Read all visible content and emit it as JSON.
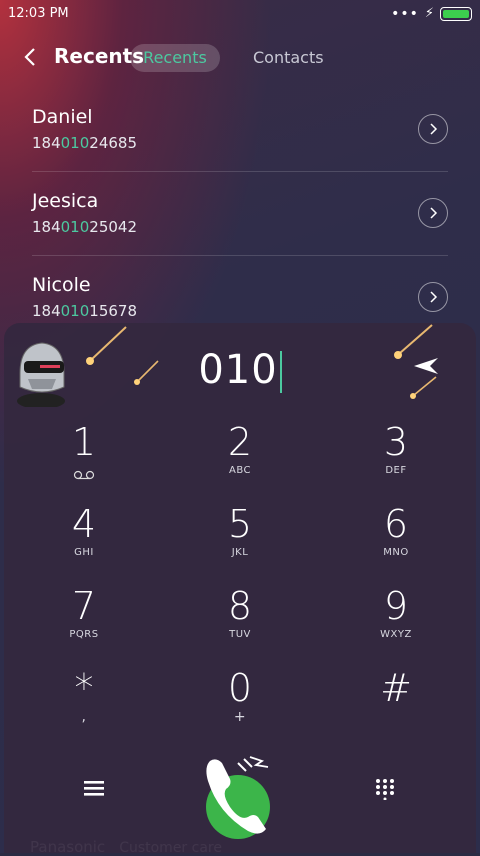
{
  "status_bar": {
    "time": "12:03 PM",
    "signal_dots": "•••"
  },
  "header": {
    "title": "Recents",
    "tabs": [
      {
        "label": "Recents",
        "active": true
      },
      {
        "label": "Contacts",
        "active": false
      }
    ]
  },
  "contacts": [
    {
      "name": "Daniel",
      "num_pre": "184",
      "num_match": "010",
      "num_post": "24685"
    },
    {
      "name": "Jeesica",
      "num_pre": "184",
      "num_match": "010",
      "num_post": "25042"
    },
    {
      "name": "Nicole",
      "num_pre": "184",
      "num_match": "010",
      "num_post": "15678"
    }
  ],
  "peek_row": {
    "name": "Panasonic",
    "subtitle": "Customer care"
  },
  "dialer": {
    "entered_number": "010",
    "keys": [
      {
        "digit": "1",
        "letters": ""
      },
      {
        "digit": "2",
        "letters": "ABC"
      },
      {
        "digit": "3",
        "letters": "DEF"
      },
      {
        "digit": "4",
        "letters": "GHI"
      },
      {
        "digit": "5",
        "letters": "JKL"
      },
      {
        "digit": "6",
        "letters": "MNO"
      },
      {
        "digit": "7",
        "letters": "PQRS"
      },
      {
        "digit": "8",
        "letters": "TUV"
      },
      {
        "digit": "9",
        "letters": "WXYZ"
      },
      {
        "digit": "*",
        "letters": ","
      },
      {
        "digit": "0",
        "letters": "+"
      },
      {
        "digit": "#",
        "letters": ""
      }
    ]
  },
  "colors": {
    "accent": "#4cc9a0",
    "call_green": "#3cb54a",
    "battery": "#3ccf4e"
  },
  "icons": [
    "back-arrow-icon",
    "chevron-right-icon",
    "voicemail-icon",
    "menu-icon",
    "dialpad-icon",
    "phone-call-icon",
    "paper-plane-icon",
    "battery-icon",
    "charging-bolt-icon"
  ]
}
